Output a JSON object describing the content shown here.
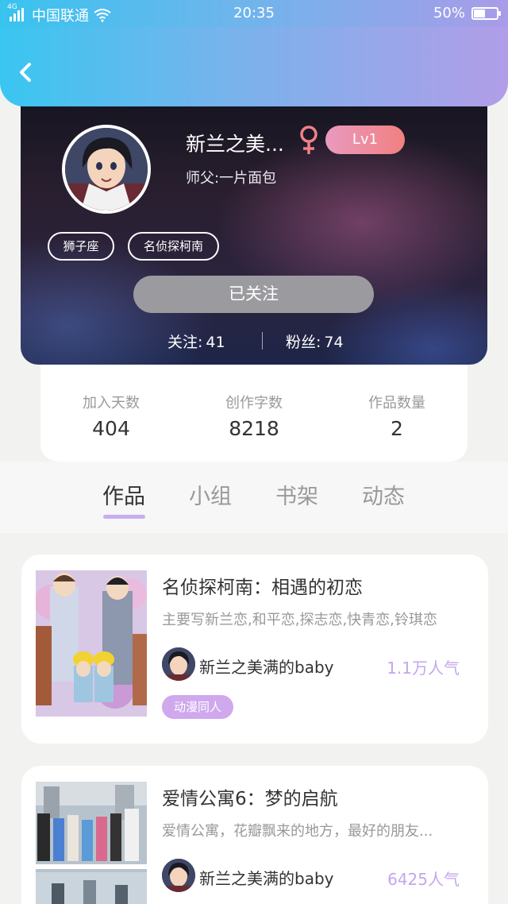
{
  "status_bar": {
    "network": "4G",
    "carrier": "中国联通",
    "time": "20:35",
    "battery": "50%",
    "battery_level": 0.5
  },
  "header": {
    "back_icon": "chevron-left-icon"
  },
  "profile": {
    "username": "新兰之美...",
    "gender_icon": "female-icon",
    "level": "Lv1",
    "master": "师父:一片面包",
    "tags": [
      "狮子座",
      "名侦探柯南"
    ],
    "follow_button": "已关注",
    "following_label": "关注:",
    "following_count": "41",
    "fans_label": "粉丝:",
    "fans_count": "74"
  },
  "stats": [
    {
      "label": "加入天数",
      "value": "404"
    },
    {
      "label": "创作字数",
      "value": "8218"
    },
    {
      "label": "作品数量",
      "value": "2"
    }
  ],
  "tabs": [
    {
      "label": "作品",
      "active": true
    },
    {
      "label": "小组",
      "active": false
    },
    {
      "label": "书架",
      "active": false
    },
    {
      "label": "动态",
      "active": false
    }
  ],
  "works": [
    {
      "title": "名侦探柯南：相遇的初恋",
      "description": "主要写新兰恋,和平恋,探志恋,快青恋,铃琪恋",
      "author": "新兰之美满的baby",
      "popularity": "1.1万人气",
      "category": "动漫同人"
    },
    {
      "title": "爱情公寓6：梦的启航",
      "description": "爱情公寓，花瓣飘来的地方，最好的朋友...",
      "author": "新兰之美满的baby",
      "popularity": "6425人气",
      "category": ""
    }
  ],
  "colors": {
    "header_gradient_start": "#39c6f0",
    "header_gradient_end": "#b19de8",
    "accent_purple": "#c4a6ec",
    "level_badge": "#f1807f",
    "follow_button": "#9b9b9f"
  }
}
